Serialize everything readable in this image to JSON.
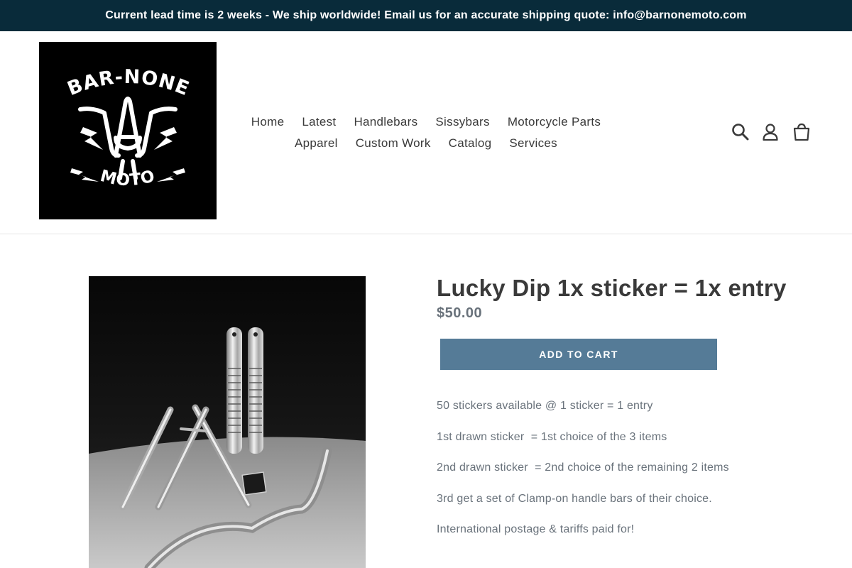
{
  "announcement": {
    "text": "Current lead time is 2 weeks - We ship worldwide! Email us for an accurate shipping quote: info@barnonemoto.com"
  },
  "header": {
    "logo": {
      "text_top": "BAR-NONE",
      "text_bottom": "MOTO"
    },
    "nav": {
      "row1": [
        {
          "label": "Home"
        },
        {
          "label": "Latest"
        },
        {
          "label": "Handlebars"
        },
        {
          "label": "Sissybars"
        },
        {
          "label": "Motorcycle Parts"
        }
      ],
      "row2": [
        {
          "label": "Apparel"
        },
        {
          "label": "Custom Work"
        },
        {
          "label": "Catalog"
        },
        {
          "label": "Services"
        }
      ]
    },
    "icons": [
      "search-icon",
      "account-icon",
      "cart-icon"
    ]
  },
  "product": {
    "title": "Lucky Dip 1x sticker = 1x entry",
    "price": "$50.00",
    "add_to_cart_label": "ADD TO CART",
    "description": [
      "50 stickers available @ 1 sticker = 1 entry",
      "1st drawn sticker  = 1st choice of the 3 items",
      "2nd drawn sticker  = 2nd choice of the remaining 2 items",
      "3rd get a set of Clamp-on handle bars of their choice.",
      "International postage & tariffs paid for!"
    ]
  },
  "colors": {
    "announcement_bg": "#092b3a",
    "button_bg": "#557b97",
    "price": "#69727b",
    "text": "#3a3a3a"
  }
}
